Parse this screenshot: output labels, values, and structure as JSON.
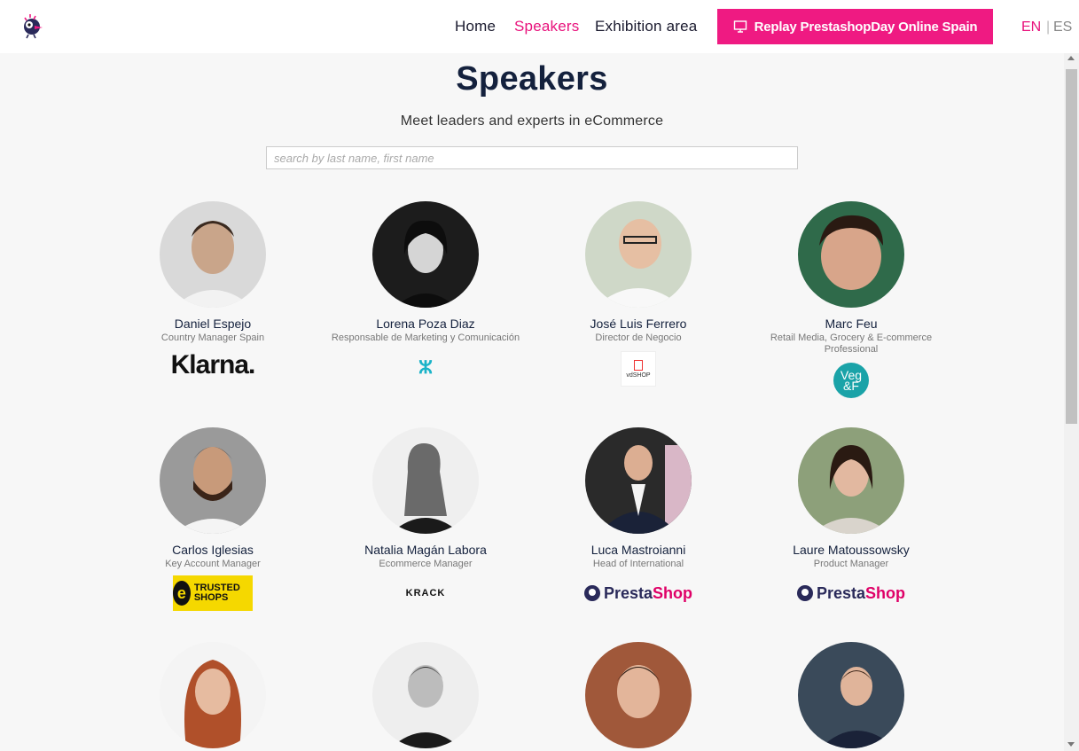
{
  "header": {
    "nav": [
      {
        "label": "Home",
        "active": false
      },
      {
        "label": "Speakers",
        "active": true
      },
      {
        "label": "Exhibition area",
        "active": false
      }
    ],
    "replay_button": "Replay PrestashopDay Online Spain",
    "lang": {
      "en": "EN",
      "separator": "|",
      "es": "ES"
    }
  },
  "main": {
    "title": "Speakers",
    "subtitle": "Meet leaders and experts in eCommerce",
    "search_placeholder": "search by last name, first name"
  },
  "speakers": [
    {
      "name": "Daniel Espejo",
      "role": "Country Manager Spain",
      "company_logo": "Klarna."
    },
    {
      "name": "Lorena Poza Diaz",
      "role": "Responsable de Marketing y Comunicación",
      "company_logo": "bluetag-icon"
    },
    {
      "name": "José Luis Ferrero",
      "role": "Director de Negocio",
      "company_logo": "vdSHOP"
    },
    {
      "name": "Marc Feu",
      "role": "Retail Media, Grocery & E-commerce Professional",
      "company_logo": "Veg &F"
    },
    {
      "name": "Carlos Iglesias",
      "role": "Key Account Manager",
      "company_logo": "TRUSTED SHOPS"
    },
    {
      "name": "Natalia Magán Labora",
      "role": "Ecommerce Manager",
      "company_logo": "KRACK"
    },
    {
      "name": "Luca Mastroianni",
      "role": "Head of International",
      "company_logo": "PrestaShop"
    },
    {
      "name": "Laure Matoussowsky",
      "role": "Product Manager",
      "company_logo": "PrestaShop"
    },
    {
      "name": "",
      "role": "",
      "company_logo": ""
    },
    {
      "name": "",
      "role": "",
      "company_logo": ""
    },
    {
      "name": "",
      "role": "",
      "company_logo": ""
    },
    {
      "name": "",
      "role": "",
      "company_logo": ""
    }
  ],
  "logos": {
    "klarna": "Klarna.",
    "trusted_e": "e",
    "trusted_text": "TRUSTED SHOPS",
    "presta_1": "Presta",
    "presta_2": "Shop",
    "krack": "KRACK",
    "vdshop": "vdSHOP",
    "vegf": "Veg &F"
  },
  "colors": {
    "accent": "#ef1a82",
    "title": "#14213d"
  }
}
